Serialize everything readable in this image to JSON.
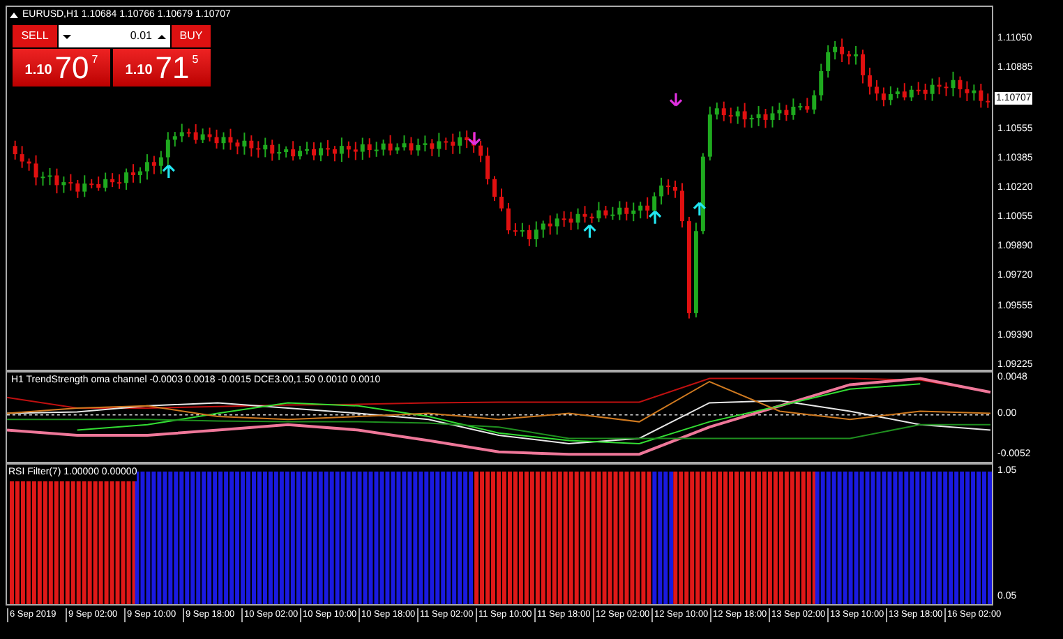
{
  "chart": {
    "title": "EURUSD,H1  1.10684 1.10766 1.10679 1.10707",
    "price_axis": [
      {
        "kind": "tick",
        "text": "1.11050"
      },
      {
        "kind": "tick",
        "text": "1.10885"
      },
      {
        "kind": "current",
        "text": "1.10707"
      },
      {
        "kind": "tick",
        "text": "1.10555"
      },
      {
        "kind": "tick",
        "text": "1.10385"
      },
      {
        "kind": "tick",
        "text": "1.10220"
      },
      {
        "kind": "tick",
        "text": "1.10055"
      },
      {
        "kind": "tick",
        "text": "1.09890"
      },
      {
        "kind": "tick",
        "text": "1.09720"
      },
      {
        "kind": "tick",
        "text": "1.09555"
      },
      {
        "kind": "tick",
        "text": "1.09390"
      },
      {
        "kind": "tick",
        "text": "1.09225"
      }
    ]
  },
  "trade_panel": {
    "sell": {
      "label": "SELL",
      "big": "1.10",
      "pips": "70",
      "frac": "7"
    },
    "buy": {
      "label": "BUY",
      "big": "1.10",
      "pips": "71",
      "frac": "5"
    },
    "lot": "0.01"
  },
  "indicator": {
    "label": "H1 TrendStrength oma channel -0.0003 0.0018 -0.0015  DCE3.00,1.50 0.0010 0.0010",
    "chart_data": {
      "type": "line",
      "ylim": [
        -0.0062,
        0.0056
      ],
      "yticks": [
        {
          "value": 0.0048,
          "label": "0.0048"
        },
        {
          "value": 0,
          "label": "0.00"
        },
        {
          "value": -0.0052,
          "label": "-0.0052"
        }
      ],
      "series": [
        {
          "color": "#c01010",
          "values": [
            0.0023,
            0.0009,
            0.0009,
            0.0011,
            0.0013,
            0.0014,
            0.0016,
            0.0017,
            0.0017,
            0.0017,
            0.0048,
            0.0048,
            0.0048,
            0.0046,
            0.003
          ]
        },
        {
          "color": "#e8e8e8",
          "values": [
            0.0002,
            0.0004,
            0.0012,
            0.0016,
            0.0009,
            0.0002,
            -0.0006,
            -0.0027,
            -0.0038,
            -0.0031,
            0.0016,
            0.0019,
            0.0005,
            -0.0013,
            -0.002
          ]
        },
        {
          "color": "#ee7799",
          "values": [
            -0.002,
            -0.0027,
            -0.0027,
            -0.002,
            -0.0013,
            -0.002,
            -0.0034,
            -0.0049,
            -0.0052,
            -0.0052,
            -0.0016,
            0.0012,
            0.004,
            0.0048,
            0.003
          ]
        },
        {
          "color": "#33dd33",
          "values": [
            null,
            -0.002,
            -0.0013,
            0.0002,
            0.0016,
            0.0012,
            -0.0002,
            -0.0024,
            -0.0034,
            -0.0038,
            -0.0009,
            0.0012,
            0.0034,
            0.0041,
            null
          ]
        },
        {
          "color": "#1f8f1f",
          "values": [
            -0.0006,
            -0.0006,
            -0.0006,
            -0.0008,
            -0.0009,
            -0.0009,
            -0.0011,
            -0.0016,
            -0.0031,
            -0.0031,
            -0.0031,
            -0.0031,
            -0.0031,
            -0.0013,
            -0.0013
          ]
        },
        {
          "color": "#d07a20",
          "values": [
            0.0002,
            0.0009,
            0.0012,
            -0.0002,
            -0.0006,
            -0.0002,
            0.0002,
            -0.0006,
            0.0002,
            -0.0009,
            0.0044,
            0.0005,
            -0.0006,
            0.0005,
            0.0002
          ]
        }
      ]
    }
  },
  "rsi": {
    "label": "RSI Filter(7) 1.00000 0.00000",
    "axis": [
      "1.05",
      "0.05"
    ]
  },
  "time_axis": [
    "6 Sep 2019",
    "9 Sep 02:00",
    "9 Sep 10:00",
    "9 Sep 18:00",
    "10 Sep 02:00",
    "10 Sep 10:00",
    "10 Sep 18:00",
    "11 Sep 02:00",
    "11 Sep 10:00",
    "11 Sep 18:00",
    "12 Sep 02:00",
    "12 Sep 10:00",
    "12 Sep 18:00",
    "13 Sep 02:00",
    "13 Sep 10:00",
    "13 Sep 18:00",
    "16 Sep 02:00"
  ]
}
